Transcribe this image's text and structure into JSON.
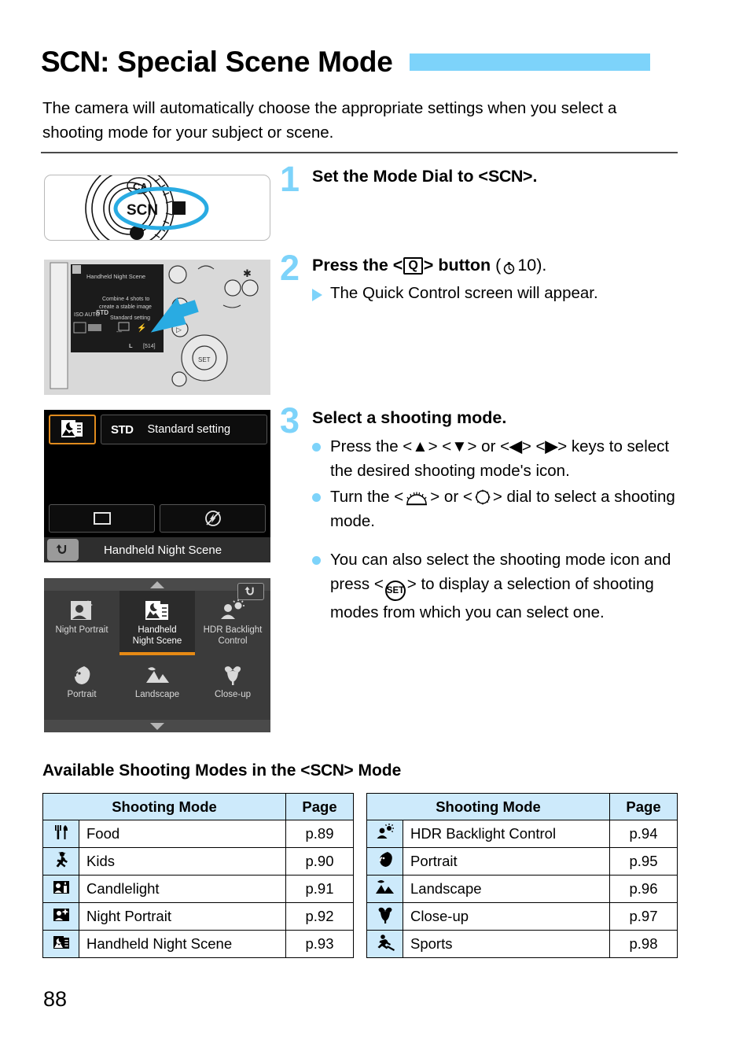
{
  "header": {
    "title_prefix": "SCN",
    "title_rest": ": Special Scene Mode",
    "bar_color": "#7dd3fa",
    "intro": "The camera will automatically choose the appropriate settings when you select a shooting mode for your subject or scene."
  },
  "steps": [
    {
      "number": "1",
      "heading_pre": "Set the Mode Dial to <",
      "heading_icon": "SCN",
      "heading_post": ">."
    },
    {
      "number": "2",
      "heading_pre": "Press the <",
      "heading_icon": "Q",
      "heading_post": "> button",
      "heading_suffix": "10",
      "detail": "The Quick Control screen will appear."
    },
    {
      "number": "3",
      "heading": "Select a shooting mode.",
      "bullets": [
        "keys to select the desired shooting mode's icon.",
        "dial to select a shooting mode.",
        "to display a selection of shooting modes from which you can select one."
      ],
      "bullet1_pre": "Press the <",
      "bullet1_keys": "▲ ▼ ◀ ▶",
      "bullet2_pre": "Turn the <",
      "bullet2_mid": "> or <",
      "bullet3_pre": "You can also select the shooting mode icon and press <",
      "bullet3_key": "SET"
    }
  ],
  "figures": {
    "mode_dial": {
      "label": "SCN",
      "neighbor_label": "CA",
      "highlight_color": "#29abe2"
    },
    "camera_back": {
      "screen_title": "Handheld Night Scene",
      "screen_line1": "Combine 4 shots to",
      "screen_line2": "create a stable image",
      "screen_setting": "Standard setting",
      "iso": "ISO AUTO",
      "picture_style": "STD",
      "quality": "L",
      "shots": "[514]",
      "arrow_color": "#29abe2"
    },
    "quick_control": {
      "picture_style_badge": "STD",
      "setting_label": "Standard setting",
      "bottom_label": "Handheld Night Scene",
      "back_icon": "↶",
      "selected_border_color": "#e08b1e"
    },
    "mode_select": {
      "back_icon": "↶",
      "selected_underline_color": "#e68a15",
      "items": [
        {
          "label_l1": "Night Portrait",
          "label_l2": "",
          "icon": "night-portrait-icon",
          "selected": false
        },
        {
          "label_l1": "Handheld",
          "label_l2": "Night Scene",
          "icon": "handheld-night-scene-icon",
          "selected": true
        },
        {
          "label_l1": "HDR Backlight",
          "label_l2": "Control",
          "icon": "hdr-backlight-control-icon",
          "selected": false
        },
        {
          "label_l1": "Portrait",
          "label_l2": "",
          "icon": "portrait-icon",
          "selected": false
        },
        {
          "label_l1": "Landscape",
          "label_l2": "",
          "icon": "landscape-icon",
          "selected": false
        },
        {
          "label_l1": "Close-up",
          "label_l2": "",
          "icon": "close-up-icon",
          "selected": false
        }
      ]
    }
  },
  "table_section": {
    "title_pre": "Available Shooting Modes in the <",
    "title_icon": "SCN",
    "title_post": "> Mode",
    "header_bg": "#cdeafb",
    "columns": [
      "Shooting Mode",
      "Page"
    ],
    "left_rows": [
      {
        "icon": "food-icon",
        "name": "Food",
        "page": "p.89"
      },
      {
        "icon": "kids-icon",
        "name": "Kids",
        "page": "p.90"
      },
      {
        "icon": "candlelight-icon",
        "name": "Candlelight",
        "page": "p.91"
      },
      {
        "icon": "night-portrait-icon",
        "name": "Night Portrait",
        "page": "p.92"
      },
      {
        "icon": "handheld-night-scene-icon",
        "name": "Handheld Night Scene",
        "page": "p.93"
      }
    ],
    "right_rows": [
      {
        "icon": "hdr-backlight-control-icon",
        "name": "HDR Backlight Control",
        "page": "p.94"
      },
      {
        "icon": "portrait-icon",
        "name": "Portrait",
        "page": "p.95"
      },
      {
        "icon": "landscape-icon",
        "name": "Landscape",
        "page": "p.96"
      },
      {
        "icon": "close-up-icon",
        "name": "Close-up",
        "page": "p.97"
      },
      {
        "icon": "sports-icon",
        "name": "Sports",
        "page": "p.98"
      }
    ]
  },
  "footer": {
    "page_number": "88"
  }
}
